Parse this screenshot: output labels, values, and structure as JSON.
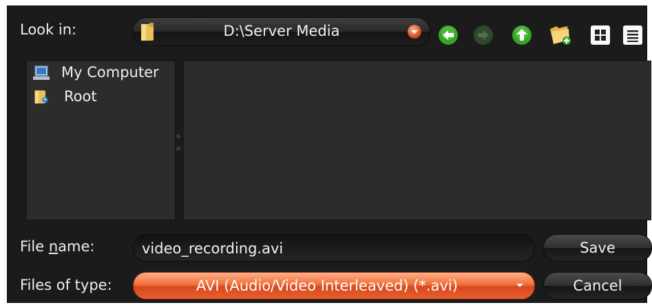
{
  "lookin": {
    "label": "Look in:",
    "path": "D:\\Server Media"
  },
  "toolbar": {
    "back_icon": "arrow-left-icon",
    "forward_icon": "arrow-right-icon",
    "up_icon": "arrow-up-icon",
    "new_folder_icon": "new-folder-icon",
    "list_view_icon": "grid-icon",
    "detail_view_icon": "detail-list-icon"
  },
  "places": [
    {
      "label": "My Computer",
      "icon": "computer-icon"
    },
    {
      "label": "Root",
      "icon": "folder-icon"
    }
  ],
  "filename": {
    "label": "File name:",
    "value": "video_recording.avi"
  },
  "filetype": {
    "label": "Files of type:",
    "value": "AVI (Audio/Video Interleaved) (*.avi)"
  },
  "buttons": {
    "save": "Save",
    "cancel": "Cancel"
  },
  "colors": {
    "accent": "#e8602e",
    "background": "#1b1b1b",
    "pane": "#2c2c2c",
    "nav_green": "#3aa32a"
  }
}
